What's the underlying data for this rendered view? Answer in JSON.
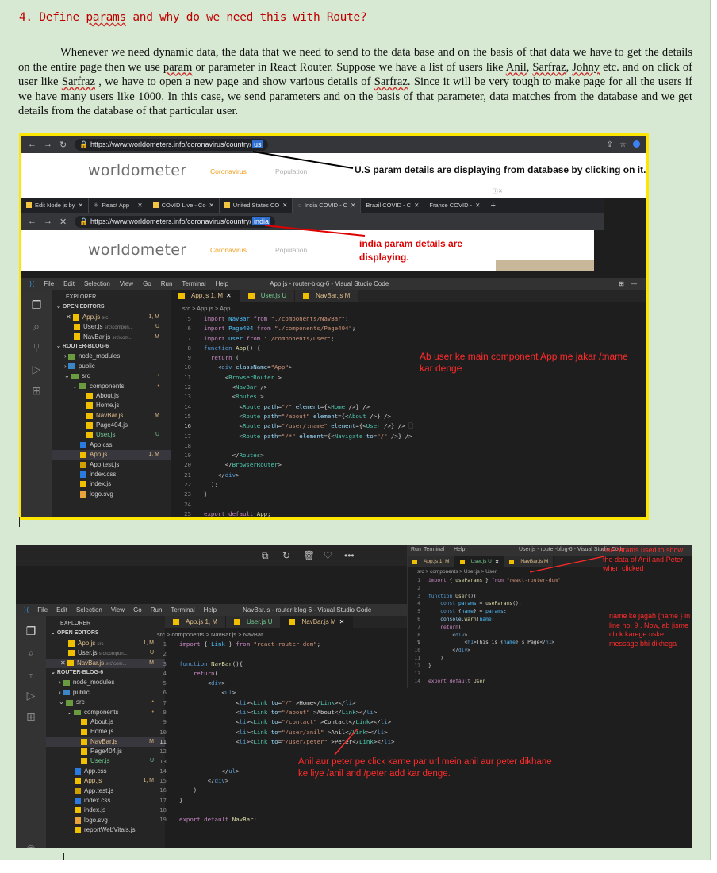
{
  "heading": {
    "number": "4.",
    "pre": "Define ",
    "word_params": "params",
    "post": " and why do we need this with Route?"
  },
  "paragraph": {
    "p1": "Whenever we need dynamic data, the data that we need to send to the data base and on the basis of that data we have to get the details on the entire page then we use ",
    "param": "param",
    "p2": " or parameter in React Router. Suppose we have a list of users  like ",
    "anil": "Anil",
    "comma1": ", ",
    "sarfraz1": "Sarfraz",
    "comma2": ", ",
    "johny": "Johny",
    "p3": " etc. and on click of user like ",
    "sarfraz2": "Sarfraz",
    "p4": " , we have to open a new page and show various details of ",
    "sarfraz3": "Sarfraz",
    "p5": ". Since it will be very tough to make page for all the users if we have many users like 1000. In this case, we send parameters and on the basis of that parameter, data matches from the database and  we get details from the database of that particular user."
  },
  "screenshot1": {
    "browser1": {
      "url": "https://www.worldometers.info/coronavirus/country/",
      "url_highlight": "us",
      "logo": "worldometer",
      "tab_corona": "Coronavirus",
      "tab_population": "Population",
      "note": "U.S param details are displaying from database by clicking on it."
    },
    "browser2": {
      "tabs": [
        "Edit Node js by",
        "React App",
        "COVID Live - Co",
        "United States CO",
        "India COVID - C",
        "Brazil COVID - C",
        "France COVID -"
      ],
      "url": "https://www.worldometers.info/coronavirus/country/",
      "url_highlight": "india",
      "logo": "worldometer",
      "tab_corona": "Coronavirus",
      "tab_population": "Population",
      "note": "india param details are displaying."
    },
    "vscode": {
      "menu": [
        "File",
        "Edit",
        "Selection",
        "View",
        "Go",
        "Run",
        "Terminal",
        "Help"
      ],
      "window_title": "App.js - router-blog-6 - Visual Studio Code",
      "explorer_title": "EXPLORER",
      "open_editors": "OPEN EDITORS",
      "open_files": [
        {
          "name": "App.js",
          "path": "src",
          "badge": "1, M"
        },
        {
          "name": "User.js",
          "path": "src\\compon...",
          "badge": "U"
        },
        {
          "name": "NavBar.js",
          "path": "src\\com...",
          "badge": "M"
        }
      ],
      "project": "ROUTER-BLOG-6",
      "tree": [
        {
          "name": "node_modules",
          "kind": "folder",
          "badge": ""
        },
        {
          "name": "public",
          "kind": "folder",
          "badge": ""
        },
        {
          "name": "src",
          "kind": "folder",
          "badge": ""
        },
        {
          "name": "components",
          "kind": "folder",
          "badge": ""
        },
        {
          "name": "About.js",
          "kind": "file",
          "badge": ""
        },
        {
          "name": "Home.js",
          "kind": "file",
          "badge": ""
        },
        {
          "name": "NavBar.js",
          "kind": "file",
          "badge": "M"
        },
        {
          "name": "Page404.js",
          "kind": "file",
          "badge": ""
        },
        {
          "name": "User.js",
          "kind": "file",
          "badge": "U"
        },
        {
          "name": "App.css",
          "kind": "css",
          "badge": ""
        },
        {
          "name": "App.js",
          "kind": "file",
          "badge": "1, M"
        },
        {
          "name": "App.test.js",
          "kind": "test",
          "badge": ""
        },
        {
          "name": "index.css",
          "kind": "css",
          "badge": ""
        },
        {
          "name": "index.js",
          "kind": "file",
          "badge": ""
        },
        {
          "name": "logo.svg",
          "kind": "svg",
          "badge": ""
        }
      ],
      "tabs": [
        "App.js 1, M",
        "User.js  U",
        "NavBar.js M"
      ],
      "breadcrumb": "src > App.js > App",
      "annotation": "Ab user ke main component App me jakar /:name kar denge"
    }
  },
  "screenshot2": {
    "vscode": {
      "menu": [
        "File",
        "Edit",
        "Selection",
        "View",
        "Go",
        "Run",
        "Terminal",
        "Help"
      ],
      "window_title": "NavBar.js - router-blog-6 - Visual Studio Code",
      "explorer_title": "EXPLORER",
      "open_editors": "OPEN EDITORS",
      "open_files": [
        {
          "name": "App.js",
          "path": "src",
          "badge": "1, M"
        },
        {
          "name": "User.js",
          "path": "src\\compon...",
          "badge": "U"
        },
        {
          "name": "NavBar.js",
          "path": "src\\com...",
          "badge": "M"
        }
      ],
      "project": "ROUTER-BLOG-6",
      "tree": [
        {
          "name": "node_modules",
          "kind": "folder",
          "badge": ""
        },
        {
          "name": "public",
          "kind": "folder",
          "badge": ""
        },
        {
          "name": "src",
          "kind": "folder",
          "badge": ""
        },
        {
          "name": "components",
          "kind": "folder",
          "badge": ""
        },
        {
          "name": "About.js",
          "kind": "file",
          "badge": ""
        },
        {
          "name": "Home.js",
          "kind": "file",
          "badge": ""
        },
        {
          "name": "NavBar.js",
          "kind": "file",
          "badge": "M"
        },
        {
          "name": "Page404.js",
          "kind": "file",
          "badge": ""
        },
        {
          "name": "User.js",
          "kind": "file",
          "badge": "U"
        },
        {
          "name": "App.css",
          "kind": "css",
          "badge": ""
        },
        {
          "name": "App.js",
          "kind": "file",
          "badge": "1, M"
        },
        {
          "name": "App.test.js",
          "kind": "test",
          "badge": ""
        },
        {
          "name": "index.css",
          "kind": "css",
          "badge": ""
        },
        {
          "name": "index.js",
          "kind": "file",
          "badge": ""
        },
        {
          "name": "logo.svg",
          "kind": "svg",
          "badge": ""
        },
        {
          "name": "reportWebVitals.js",
          "kind": "file",
          "badge": ""
        }
      ],
      "tabs": [
        "App.js 1, M",
        "User.js  U",
        "NavBar.js M"
      ],
      "breadcrumb": "src > components > NavBar.js > NavBar",
      "annotation_links": "Anil aur peter pe click karne par url mein anil aur peter dikhane ke liye /anil and /peter add kar denge."
    },
    "mini_window": {
      "title": "User.js - router-blog-6 - Visual Studio Code",
      "menu": [
        "Run",
        "Terminal",
        "Help"
      ],
      "tabs": [
        "App.js 1, M",
        "User.js  U",
        "NavBar.js M"
      ],
      "breadcrumb": "src > components > User.js > User",
      "annotation_params": "useParams used to show the data of Anil and Peter when clicked",
      "annotation_name": "name ke jagah {name } in line no. 9 . Now, ab jisme click karege uske message bhi dikhega"
    }
  }
}
